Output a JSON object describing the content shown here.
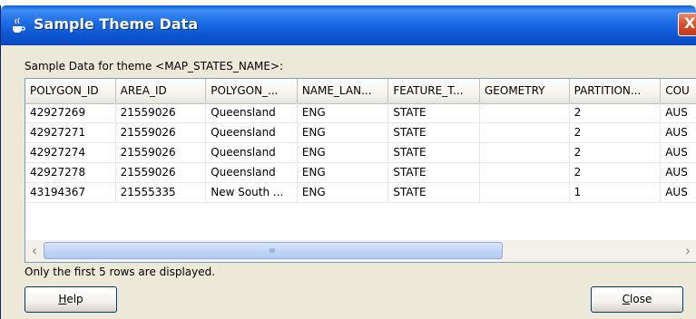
{
  "window": {
    "title": "Sample Theme Data",
    "close_glyph": "X",
    "icon": "java-cup-icon"
  },
  "caption": "Sample Data for theme <MAP_STATES_NAME>:",
  "table": {
    "columns": [
      "POLYGON_ID",
      "AREA_ID",
      "POLYGON_...",
      "NAME_LAN...",
      "FEATURE_T...",
      "GEOMETRY",
      "PARTITION...",
      "COU"
    ],
    "rows": [
      [
        "42927269",
        "21559026",
        "Queensland",
        "ENG",
        "STATE",
        "",
        "2",
        "AUS"
      ],
      [
        "42927271",
        "21559026",
        "Queensland",
        "ENG",
        "STATE",
        "",
        "2",
        "AUS"
      ],
      [
        "42927274",
        "21559026",
        "Queensland",
        "ENG",
        "STATE",
        "",
        "2",
        "AUS"
      ],
      [
        "42927278",
        "21559026",
        "Queensland",
        "ENG",
        "STATE",
        "",
        "2",
        "AUS"
      ],
      [
        "43194367",
        "21555335",
        "New South ...",
        "ENG",
        "STATE",
        "",
        "1",
        "AUS"
      ]
    ]
  },
  "footer_note": "Only the first 5 rows are displayed.",
  "buttons": {
    "help_mnemonic": "H",
    "help_rest": "elp",
    "close_mnemonic": "C",
    "close_rest": "lose"
  },
  "colors": {
    "titlebar": "#0b55d0",
    "dialog_bg": "#ece9d8",
    "close_button": "#d8502e"
  }
}
